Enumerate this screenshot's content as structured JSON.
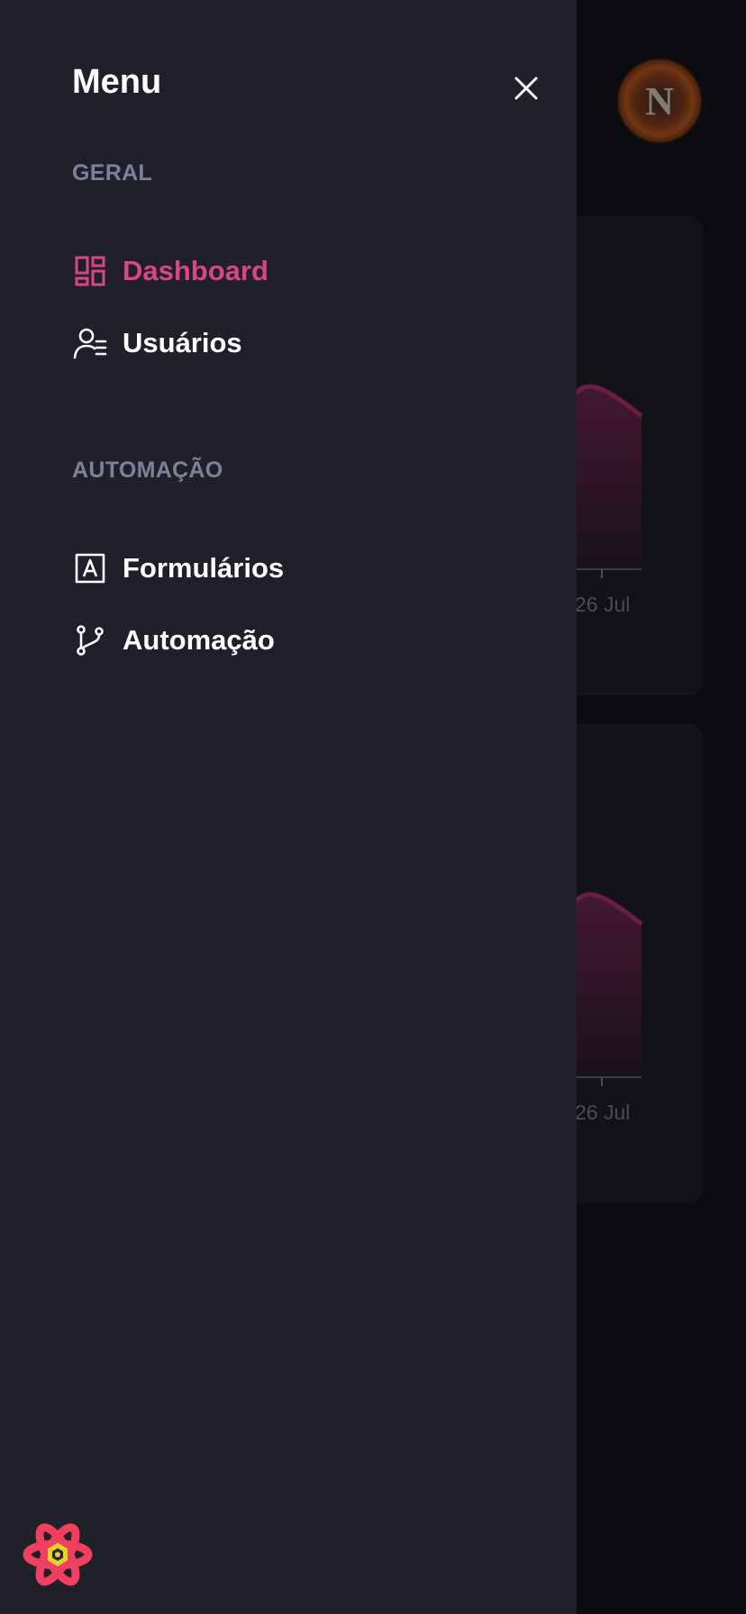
{
  "drawer": {
    "title": "Menu",
    "sections": [
      {
        "label": "GERAL",
        "items": [
          {
            "label": "Dashboard",
            "icon": "dashboard-icon",
            "active": true
          },
          {
            "label": "Usuários",
            "icon": "users-list-icon",
            "active": false
          }
        ]
      },
      {
        "label": "AUTOMAÇÃO",
        "items": [
          {
            "label": "Formulários",
            "icon": "form-icon",
            "active": false
          },
          {
            "label": "Automação",
            "icon": "git-branch-icon",
            "active": false
          }
        ]
      }
    ]
  },
  "background": {
    "avatar_initial": "N",
    "charts": [
      {
        "tick_label": "26 Jul"
      },
      {
        "tick_label": "26 Jul"
      }
    ]
  },
  "colors": {
    "drawer_bg": "#1f2029",
    "active_item": "#d94686",
    "section_label": "#7f8099",
    "page_bg": "#0b0c10",
    "chart_line": "#6b1d45"
  },
  "footer": {
    "logo_icon": "react-logo-icon"
  }
}
